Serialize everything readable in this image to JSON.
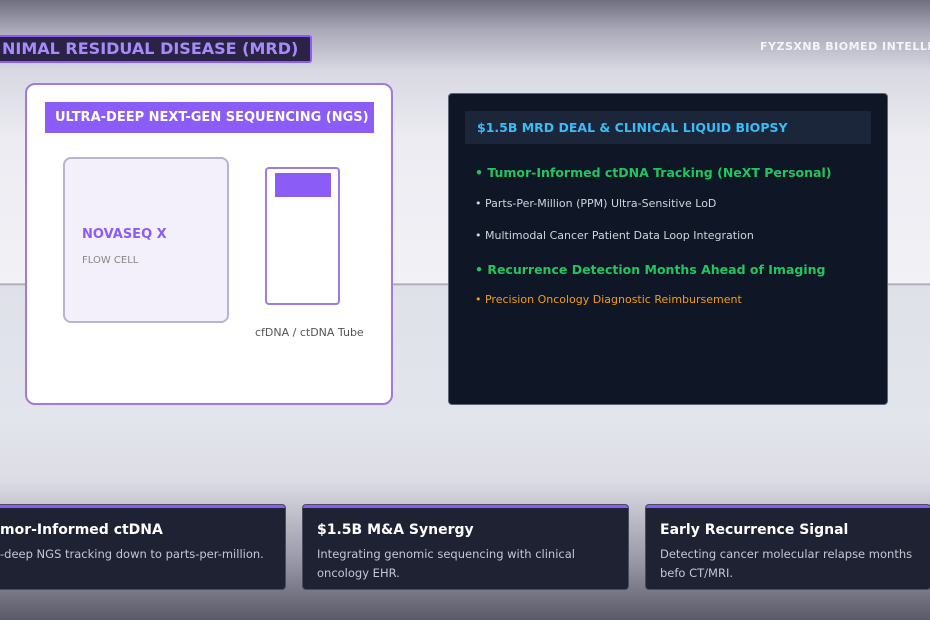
{
  "header": {
    "badge": "NIMAL RESIDUAL DISEASE (MRD)",
    "brand": "FYZSXNB BIOMED INTELLIGEN"
  },
  "ngs": {
    "title": "ULTRA-DEEP NEXT-GEN SEQUENCING (NGS)",
    "flow_cell_title": "NOVASEQ X",
    "flow_cell_sub": "FLOW CELL",
    "tube_label": "cfDNA / ctDNA Tube"
  },
  "deal": {
    "title": "$1.5B MRD DEAL & CLINICAL LIQUID BIOPSY",
    "items": [
      "• Tumor-Informed ctDNA Tracking (NeXT Personal)",
      "• Parts-Per-Million (PPM) Ultra-Sensitive LoD",
      "• Multimodal Cancer Patient Data Loop Integration",
      "• Recurrence Detection Months Ahead of Imaging",
      "• Precision Oncology Diagnostic Reimbursement"
    ]
  },
  "cards": [
    {
      "title": "mor-Informed ctDNA",
      "desc": "-deep NGS tracking down to parts-per-million."
    },
    {
      "title": "$1.5B M&A Synergy",
      "desc": "Integrating genomic sequencing with clinical oncology EHR."
    },
    {
      "title": "Early Recurrence Signal",
      "desc": "Detecting cancer molecular relapse months befo CT/MRI."
    }
  ]
}
